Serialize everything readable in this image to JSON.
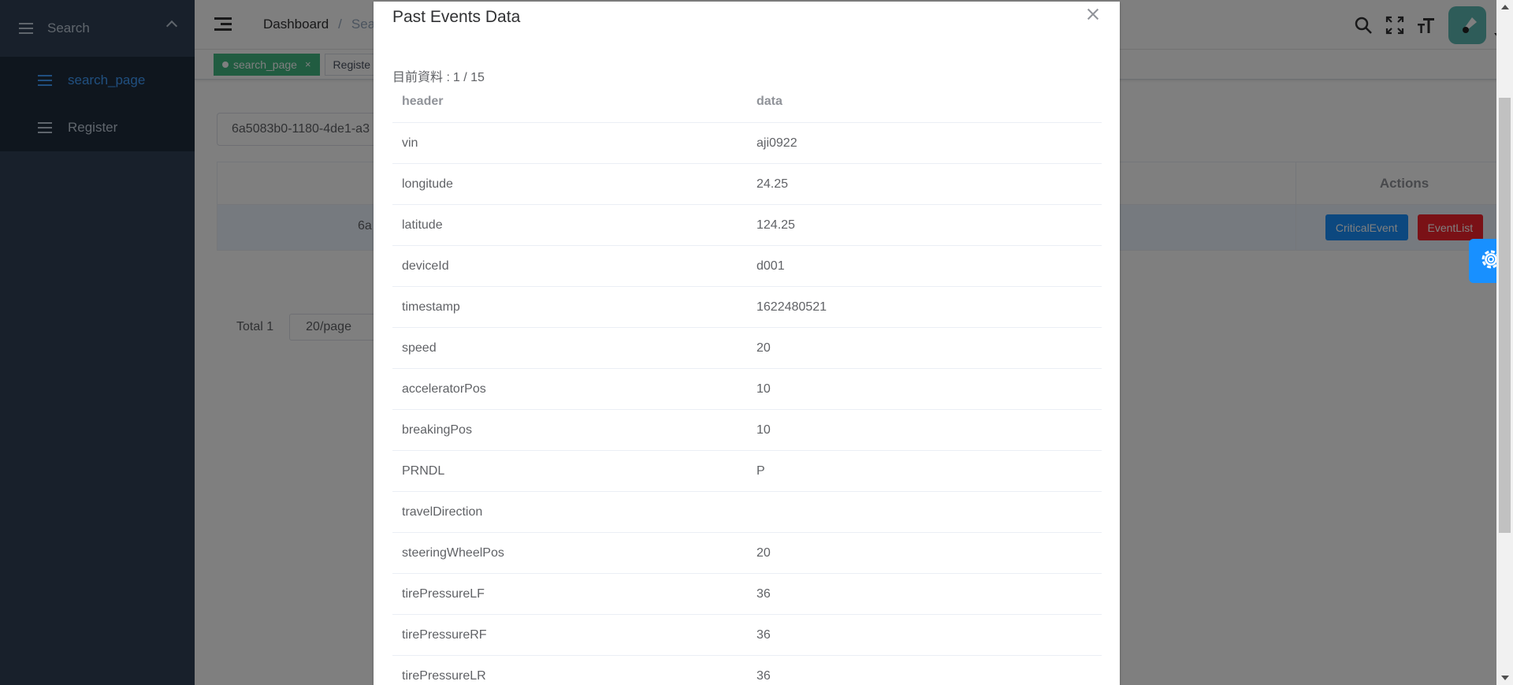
{
  "sidebar": {
    "menu_title": "Search",
    "items": [
      {
        "label": "search_page",
        "active": true
      },
      {
        "label": "Register",
        "active": false
      }
    ]
  },
  "navbar": {
    "breadcrumb": [
      "Dashboard",
      "Searc"
    ]
  },
  "tags": [
    {
      "label": "search_page",
      "active": true
    },
    {
      "label": "Registe",
      "active": false
    }
  ],
  "search": {
    "value": "6a5083b0-1180-4de1-a3"
  },
  "table": {
    "actions_header": "Actions",
    "row_id": "6a",
    "buttons": {
      "critical": "CriticalEvent",
      "eventlist": "EventList"
    }
  },
  "pagination": {
    "total": "Total 1",
    "page_size": "20/page"
  },
  "dialog": {
    "title": "Past Events Data",
    "counter_label": "目前資料 :",
    "counter_value": "1 / 15",
    "headers": {
      "header": "header",
      "data": "data"
    },
    "rows": [
      {
        "header": "vin",
        "data": "aji0922"
      },
      {
        "header": "longitude",
        "data": "24.25"
      },
      {
        "header": "latitude",
        "data": "124.25"
      },
      {
        "header": "deviceId",
        "data": "d001"
      },
      {
        "header": "timestamp",
        "data": "1622480521"
      },
      {
        "header": "speed",
        "data": "20"
      },
      {
        "header": "acceleratorPos",
        "data": "10"
      },
      {
        "header": "breakingPos",
        "data": "10"
      },
      {
        "header": "PRNDL",
        "data": "P"
      },
      {
        "header": "travelDirection",
        "data": ""
      },
      {
        "header": "steeringWheelPos",
        "data": "20"
      },
      {
        "header": "tirePressureLF",
        "data": "36"
      },
      {
        "header": "tirePressureRF",
        "data": "36"
      },
      {
        "header": "tirePressureLR",
        "data": "36"
      }
    ]
  },
  "colors": {
    "sidebar_bg": "#304156",
    "primary": "#1890ff",
    "danger": "#f5222d",
    "tag_active": "#42b983"
  }
}
